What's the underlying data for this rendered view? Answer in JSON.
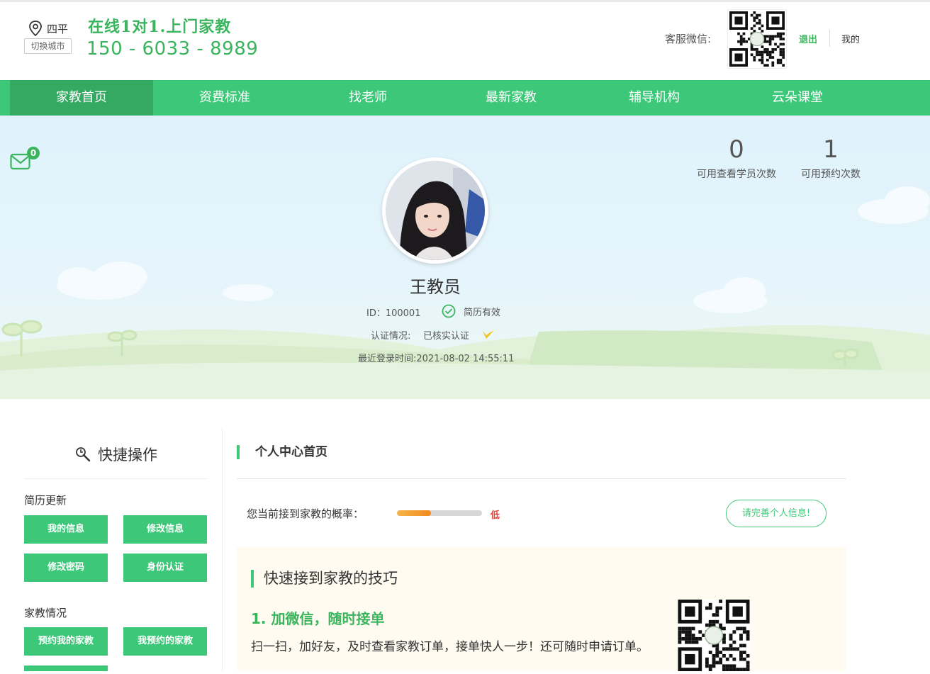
{
  "header": {
    "city": "四平",
    "switch_city": "切换城市",
    "slogan": "在线1对1.上门家教",
    "phone": "150 - 6033 - 8989",
    "service_wechat_label": "客服微信:",
    "logout": "退出",
    "mine": "我的"
  },
  "nav": {
    "items": [
      {
        "label": "家教首页",
        "active": true
      },
      {
        "label": "资费标准"
      },
      {
        "label": "找老师"
      },
      {
        "label": "最新家教"
      },
      {
        "label": "辅导机构"
      },
      {
        "label": "云朵课堂"
      }
    ]
  },
  "profile": {
    "messages": "0",
    "name": "王教员",
    "id_line": "ID：100001",
    "resume_status": "简历有效",
    "cert_label": "认证情况:",
    "cert_value": "已核实认证",
    "last_login": "最近登录时间:2021-08-02 14:55:11",
    "stats": [
      {
        "value": "0",
        "label": "可用查看学员次数"
      },
      {
        "value": "1",
        "label": "可用预约次数"
      }
    ]
  },
  "sidebar": {
    "title": "快捷操作",
    "group1": "简历更新",
    "group2": "家教情况",
    "buttons": {
      "my_info": "我的信息",
      "edit_info": "修改信息",
      "change_password": "修改密码",
      "identity_verify": "身份认证",
      "booked_me": "预约我的家教",
      "my_bookings": "我预约的家教"
    }
  },
  "main": {
    "title": "个人中心首页",
    "probability_label": "您当前接到家教的概率：",
    "probability_level": "低",
    "probability_percent": 40,
    "improve_button": "请完善个人信息!",
    "tips": {
      "title": "快速接到家教的技巧",
      "heading": "1. 加微信，随时接单",
      "text": "扫一扫，加好友，及时查看家教订单，接单快人一步！还可随时申请订单。"
    }
  },
  "colors": {
    "brand_green": "#3cc878",
    "nav_active": "#35a862",
    "warning_red": "#e2453c",
    "progress_orange": "#f18a1c"
  }
}
